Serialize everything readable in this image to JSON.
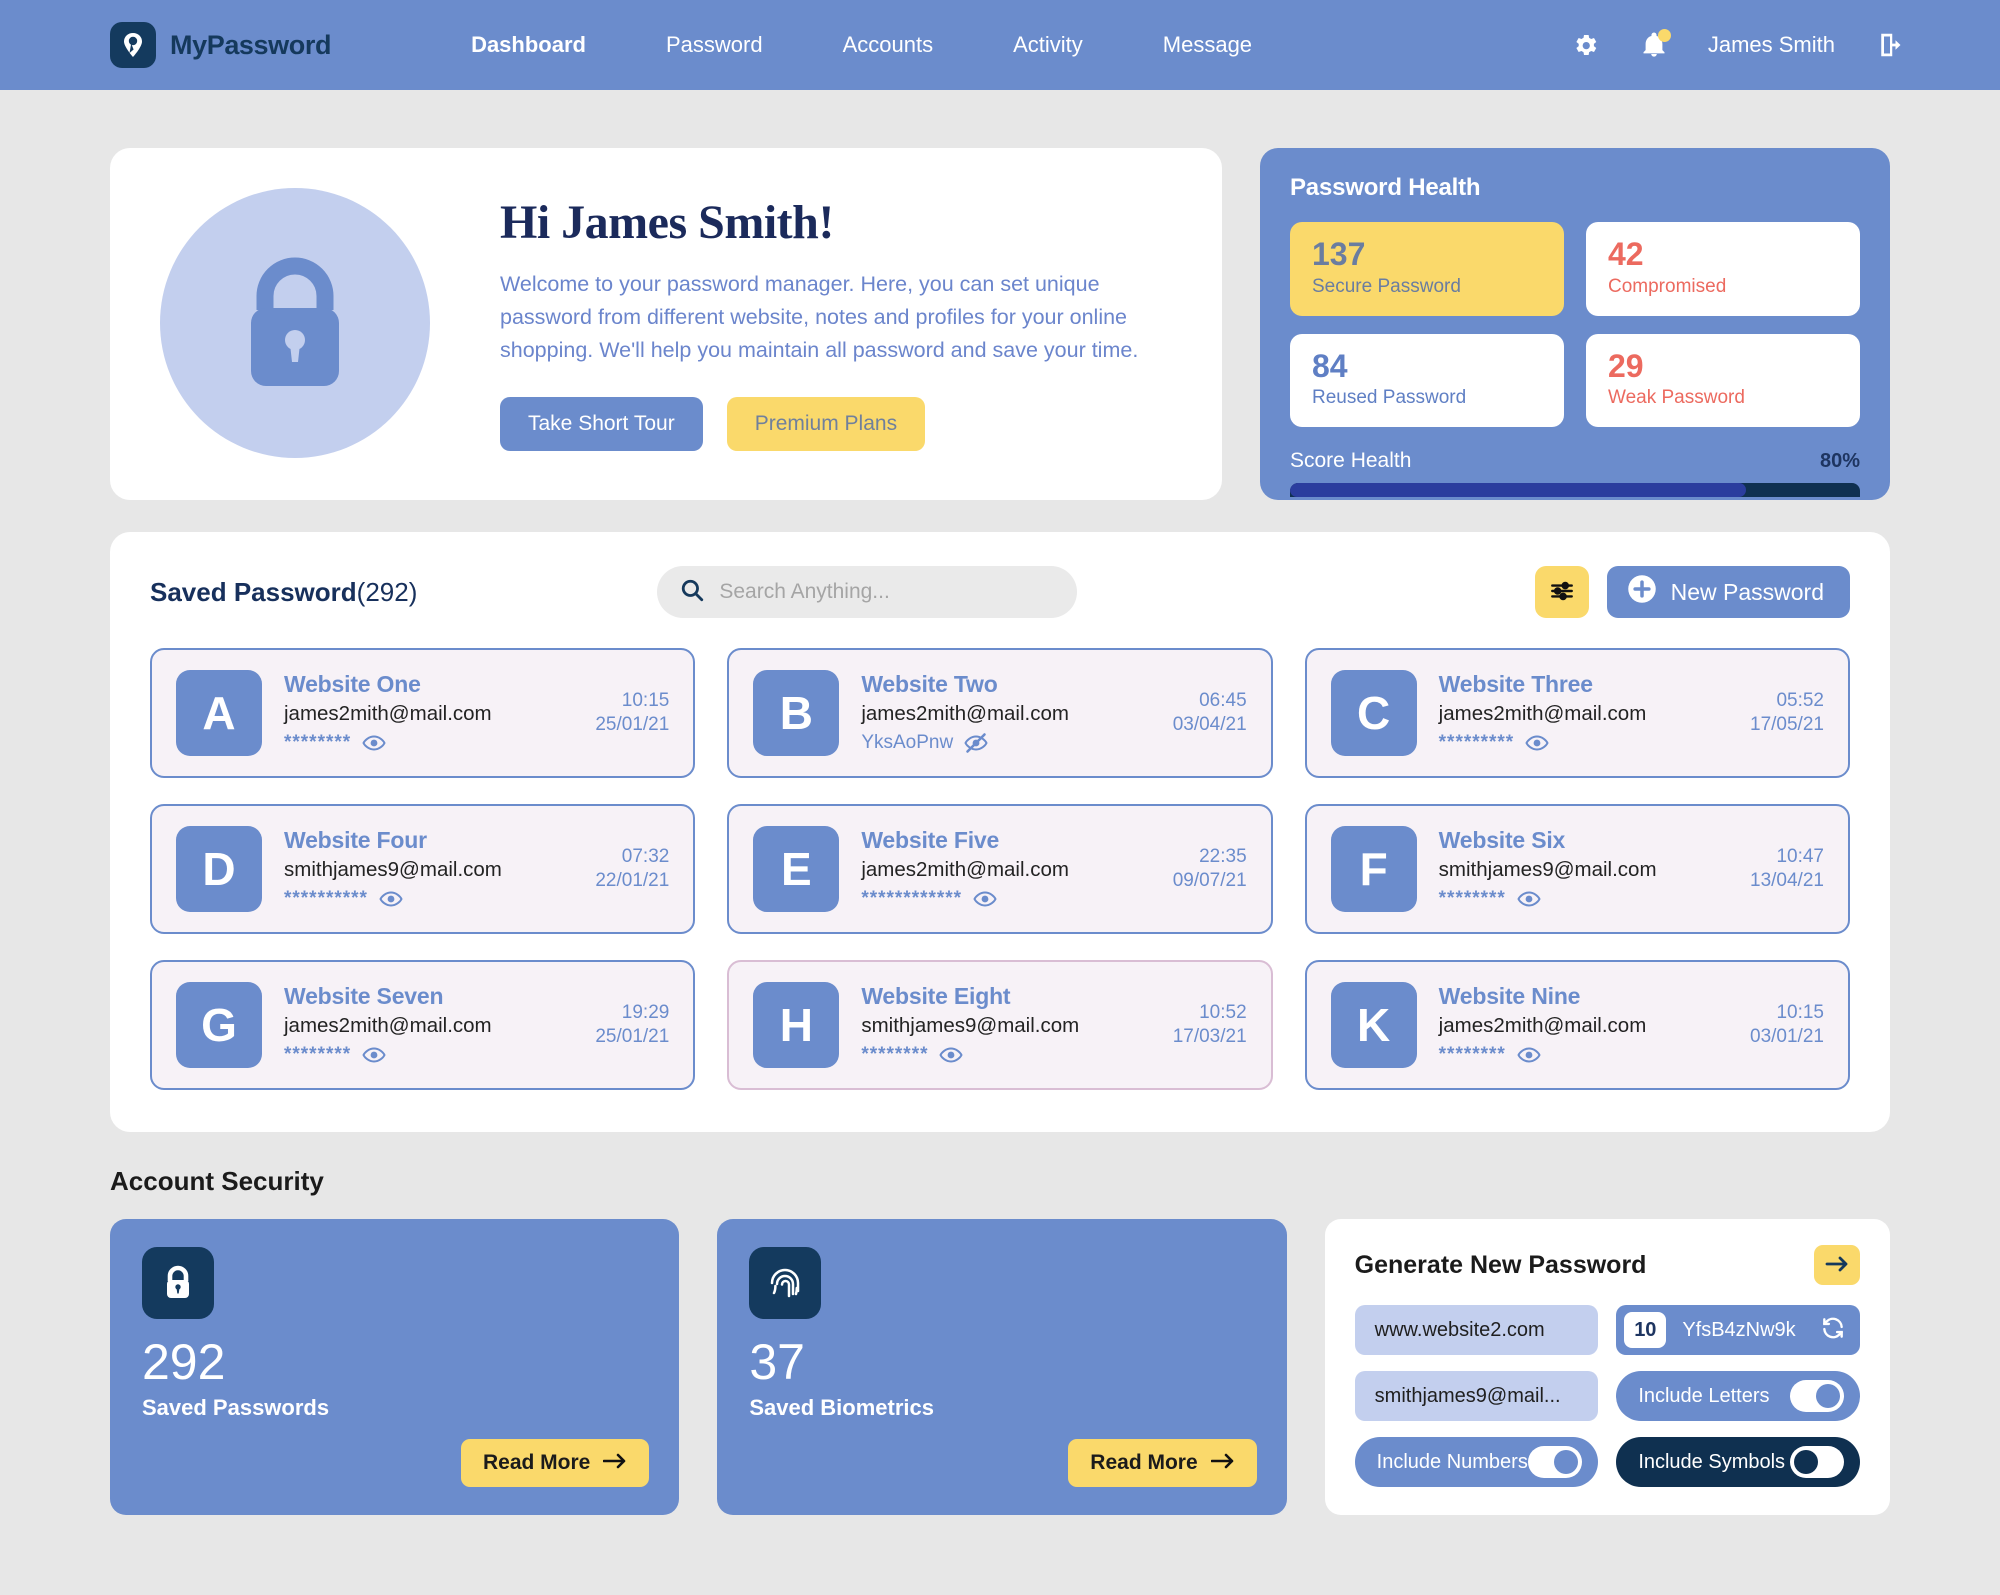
{
  "header": {
    "brand": "MyPassword",
    "nav": [
      {
        "label": "Dashboard",
        "active": true
      },
      {
        "label": "Password",
        "active": false
      },
      {
        "label": "Accounts",
        "active": false
      },
      {
        "label": "Activity",
        "active": false
      },
      {
        "label": "Message",
        "active": false
      }
    ],
    "username": "James Smith",
    "icons": [
      "gear-icon",
      "bell-icon",
      "logout-icon"
    ]
  },
  "welcome": {
    "title": "Hi James Smith!",
    "text": "Welcome to your password manager. Here, you can set unique password from different website, notes and profiles for your online shopping. We'll help you maintain all password and save your time.",
    "primary_button": "Take Short Tour",
    "secondary_button": "Premium Plans"
  },
  "health": {
    "title": "Password Health",
    "stats": [
      {
        "value": "137",
        "label": "Secure Password",
        "tone": "yellow"
      },
      {
        "value": "42",
        "label": "Compromised",
        "tone": "red"
      },
      {
        "value": "84",
        "label": "Reused Password",
        "tone": "blue"
      },
      {
        "value": "29",
        "label": "Weak Password",
        "tone": "red"
      }
    ],
    "score_label": "Score Health",
    "score_percent": "80%",
    "score_value": 80
  },
  "saved": {
    "title": "Saved Password",
    "count": "(292)",
    "search_placeholder": "Search Anything...",
    "filter_icon": "sliders-icon",
    "new_button": "New Password",
    "cards": [
      {
        "letter": "A",
        "site": "Website One",
        "email": "james2mith@mail.com",
        "password": "********",
        "revealed": false,
        "time": "10:15",
        "date": "25/01/21",
        "accent": "blue"
      },
      {
        "letter": "B",
        "site": "Website Two",
        "email": "james2mith@mail.com",
        "password": "YksAoPnw",
        "revealed": true,
        "time": "06:45",
        "date": "03/04/21",
        "accent": "blue"
      },
      {
        "letter": "C",
        "site": "Website Three",
        "email": "james2mith@mail.com",
        "password": "*********",
        "revealed": false,
        "time": "05:52",
        "date": "17/05/21",
        "accent": "blue"
      },
      {
        "letter": "D",
        "site": "Website Four",
        "email": "smithjames9@mail.com",
        "password": "**********",
        "revealed": false,
        "time": "07:32",
        "date": "22/01/21",
        "accent": "blue"
      },
      {
        "letter": "E",
        "site": "Website Five",
        "email": "james2mith@mail.com",
        "password": "************",
        "revealed": false,
        "time": "22:35",
        "date": "09/07/21",
        "accent": "blue"
      },
      {
        "letter": "F",
        "site": "Website Six",
        "email": "smithjames9@mail.com",
        "password": "********",
        "revealed": false,
        "time": "10:47",
        "date": "13/04/21",
        "accent": "blue"
      },
      {
        "letter": "G",
        "site": "Website Seven",
        "email": "james2mith@mail.com",
        "password": "********",
        "revealed": false,
        "time": "19:29",
        "date": "25/01/21",
        "accent": "blue"
      },
      {
        "letter": "H",
        "site": "Website Eight",
        "email": "smithjames9@mail.com",
        "password": "********",
        "revealed": false,
        "time": "10:52",
        "date": "17/03/21",
        "accent": "pink"
      },
      {
        "letter": "K",
        "site": "Website Nine",
        "email": "james2mith@mail.com",
        "password": "********",
        "revealed": false,
        "time": "10:15",
        "date": "03/01/21",
        "accent": "blue"
      }
    ]
  },
  "security": {
    "title": "Account Security",
    "cards": [
      {
        "icon": "lock-icon",
        "value": "292",
        "label": "Saved Passwords",
        "button": "Read More"
      },
      {
        "icon": "fingerprint-icon",
        "value": "37",
        "label": "Saved Biometrics",
        "button": "Read More"
      }
    ]
  },
  "generator": {
    "title": "Generate New Password",
    "arrow_icon": "arrow-right-icon",
    "website": "www.website2.com",
    "email": "smithjames9@mail...",
    "length": "10",
    "generated_password": "YfsB4zNw9k",
    "refresh_icon": "refresh-icon",
    "toggles": [
      {
        "label": "Include Letters",
        "on": true,
        "tone": "blue"
      },
      {
        "label": "Include Numbers",
        "on": true,
        "tone": "blue"
      },
      {
        "label": "Include Symbols",
        "on": false,
        "tone": "navy"
      }
    ]
  },
  "colors": {
    "brand_blue": "#6b8ccc",
    "navy": "#143a5e",
    "yellow": "#fad96b",
    "red": "#ec6a5f",
    "page_bg": "#e7e7e7"
  }
}
